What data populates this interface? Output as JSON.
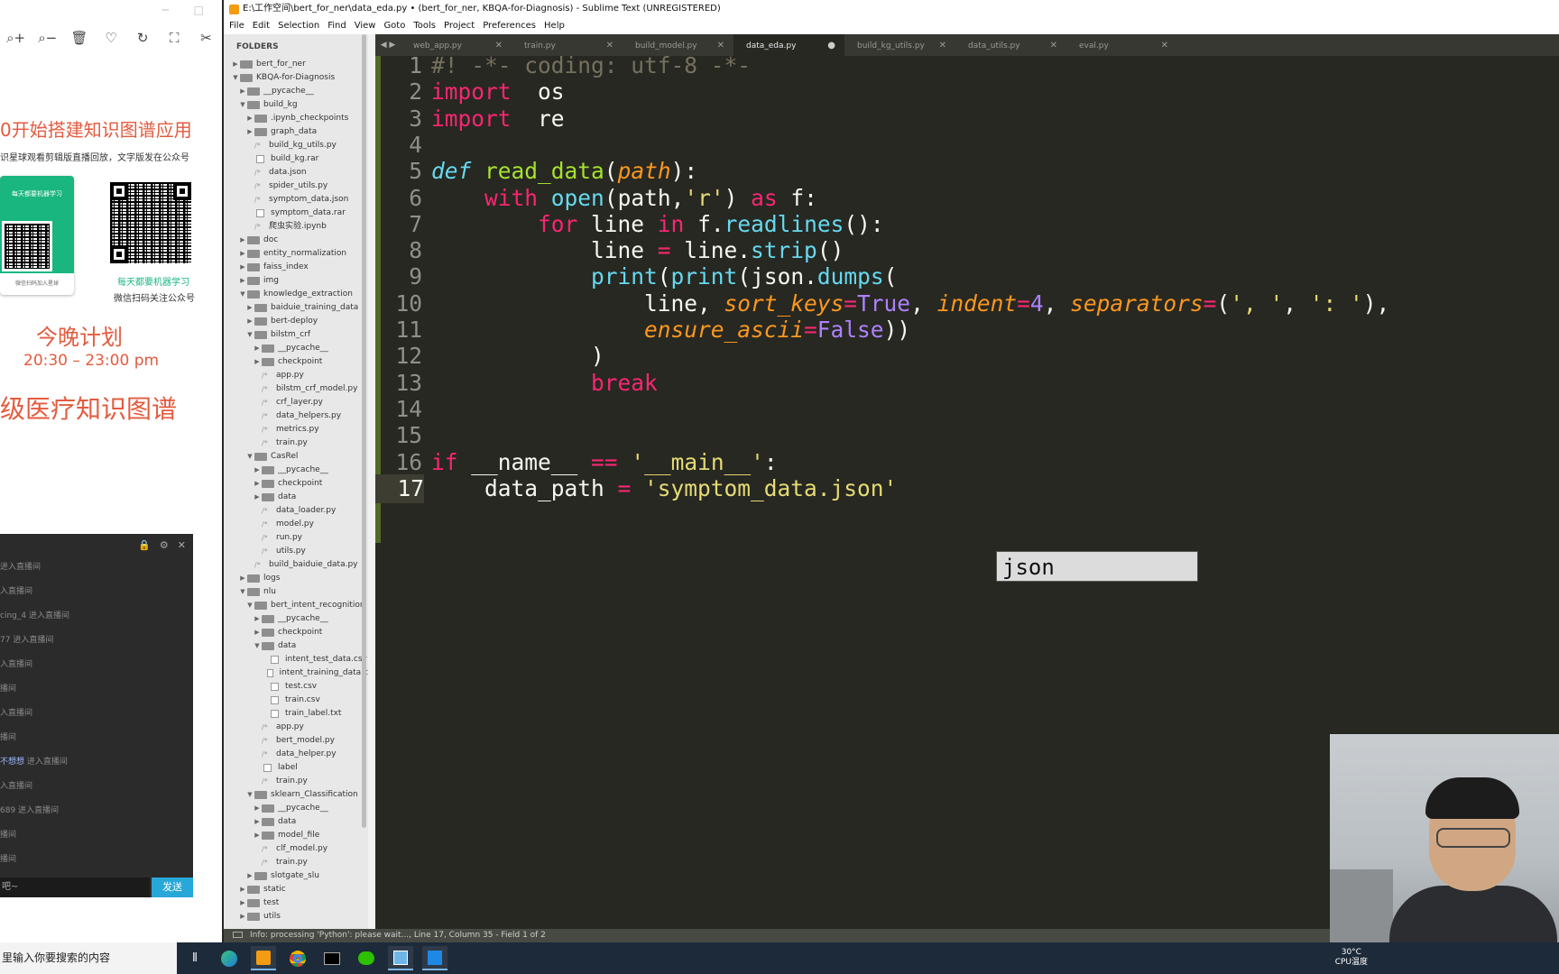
{
  "viewer": {
    "toolbar": [
      "⌕+",
      "⌕−",
      "🗑",
      "♡",
      "↻",
      "⛶",
      "✂"
    ],
    "poster": {
      "title": "0开始搭建知识图谱应用",
      "subtitle": "识星球观看剪辑版直播回放，文字版发在公众号",
      "card_text": "每天都要机器学习",
      "card_foot": "微信扫码加入星球",
      "qr_caption1": "每天都要机器学习",
      "qr_caption2": "微信扫码关注公众号",
      "plan_title": "今晚计划",
      "plan_time": "20:30 – 23:00 pm",
      "plan_topic": "级医疗知识图谱"
    },
    "chat": {
      "lines": [
        {
          "nick": "",
          "text": "进入直播间",
          "highlight": false
        },
        {
          "nick": "",
          "text": "入直播间",
          "highlight": false
        },
        {
          "nick": "cing_4",
          "text": " 进入直播间",
          "highlight": false
        },
        {
          "nick": "77",
          "text": " 进入直播间",
          "highlight": false
        },
        {
          "nick": "",
          "text": "入直播间",
          "highlight": false
        },
        {
          "nick": "",
          "text": "播间",
          "highlight": false
        },
        {
          "nick": "",
          "text": "入直播间",
          "highlight": false
        },
        {
          "nick": "",
          "text": "播间",
          "highlight": false
        },
        {
          "nick": "不想想",
          "text": " 进入直播间",
          "highlight": true
        },
        {
          "nick": "",
          "text": "入直播间",
          "highlight": false
        },
        {
          "nick": "689",
          "text": " 进入直播间",
          "highlight": false
        },
        {
          "nick": "",
          "text": "播间",
          "highlight": false
        },
        {
          "nick": "",
          "text": "播间",
          "highlight": false
        }
      ],
      "input_value": "吧~",
      "send_label": "发送"
    }
  },
  "sublime": {
    "title": "E:\\工作空间\\bert_for_ner\\data_eda.py • (bert_for_ner, KBQA-for-Diagnosis) - Sublime Text (UNREGISTERED)",
    "menu": [
      "File",
      "Edit",
      "Selection",
      "Find",
      "View",
      "Goto",
      "Tools",
      "Project",
      "Preferences",
      "Help"
    ],
    "sidebar_header": "FOLDERS",
    "tree": [
      {
        "d": 0,
        "t": "folder",
        "o": false,
        "n": "bert_for_ner"
      },
      {
        "d": 0,
        "t": "folder",
        "o": true,
        "n": "KBQA-for-Diagnosis"
      },
      {
        "d": 1,
        "t": "folder",
        "o": false,
        "n": "__pycache__"
      },
      {
        "d": 1,
        "t": "folder",
        "o": true,
        "n": "build_kg"
      },
      {
        "d": 2,
        "t": "folder",
        "o": false,
        "n": ".ipynb_checkpoints"
      },
      {
        "d": 2,
        "t": "folder",
        "o": false,
        "n": "graph_data"
      },
      {
        "d": 2,
        "t": "py",
        "n": "build_kg_utils.py"
      },
      {
        "d": 2,
        "t": "file",
        "n": "build_kg.rar"
      },
      {
        "d": 2,
        "t": "py",
        "n": "data.json"
      },
      {
        "d": 2,
        "t": "py",
        "n": "spider_utils.py"
      },
      {
        "d": 2,
        "t": "py",
        "n": "symptom_data.json"
      },
      {
        "d": 2,
        "t": "file",
        "n": "symptom_data.rar"
      },
      {
        "d": 2,
        "t": "py",
        "n": "爬虫实验.ipynb"
      },
      {
        "d": 1,
        "t": "folder",
        "o": false,
        "n": "doc"
      },
      {
        "d": 1,
        "t": "folder",
        "o": false,
        "n": "entity_normalization"
      },
      {
        "d": 1,
        "t": "folder",
        "o": false,
        "n": "faiss_index"
      },
      {
        "d": 1,
        "t": "folder",
        "o": false,
        "n": "img"
      },
      {
        "d": 1,
        "t": "folder",
        "o": true,
        "n": "knowledge_extraction"
      },
      {
        "d": 2,
        "t": "folder",
        "o": false,
        "n": "baiduie_training_data"
      },
      {
        "d": 2,
        "t": "folder",
        "o": false,
        "n": "bert-deploy"
      },
      {
        "d": 2,
        "t": "folder",
        "o": true,
        "n": "bilstm_crf"
      },
      {
        "d": 3,
        "t": "folder",
        "o": false,
        "n": "__pycache__"
      },
      {
        "d": 3,
        "t": "folder",
        "o": false,
        "n": "checkpoint"
      },
      {
        "d": 3,
        "t": "py",
        "n": "app.py"
      },
      {
        "d": 3,
        "t": "py",
        "n": "bilstm_crf_model.py"
      },
      {
        "d": 3,
        "t": "py",
        "n": "crf_layer.py"
      },
      {
        "d": 3,
        "t": "py",
        "n": "data_helpers.py"
      },
      {
        "d": 3,
        "t": "py",
        "n": "metrics.py"
      },
      {
        "d": 3,
        "t": "py",
        "n": "train.py"
      },
      {
        "d": 2,
        "t": "folder",
        "o": true,
        "n": "CasRel"
      },
      {
        "d": 3,
        "t": "folder",
        "o": false,
        "n": "__pycache__"
      },
      {
        "d": 3,
        "t": "folder",
        "o": false,
        "n": "checkpoint"
      },
      {
        "d": 3,
        "t": "folder",
        "o": false,
        "n": "data"
      },
      {
        "d": 3,
        "t": "py",
        "n": "data_loader.py"
      },
      {
        "d": 3,
        "t": "py",
        "n": "model.py"
      },
      {
        "d": 3,
        "t": "py",
        "n": "run.py"
      },
      {
        "d": 3,
        "t": "py",
        "n": "utils.py"
      },
      {
        "d": 2,
        "t": "py",
        "n": "build_baiduie_data.py"
      },
      {
        "d": 1,
        "t": "folder",
        "o": false,
        "n": "logs"
      },
      {
        "d": 1,
        "t": "folder",
        "o": true,
        "n": "nlu"
      },
      {
        "d": 2,
        "t": "folder",
        "o": true,
        "n": "bert_intent_recognition"
      },
      {
        "d": 3,
        "t": "folder",
        "o": false,
        "n": "__pycache__"
      },
      {
        "d": 3,
        "t": "folder",
        "o": false,
        "n": "checkpoint"
      },
      {
        "d": 3,
        "t": "folder",
        "o": true,
        "n": "data"
      },
      {
        "d": 4,
        "t": "file",
        "n": "intent_test_data.csv"
      },
      {
        "d": 4,
        "t": "file",
        "n": "intent_training_data.c"
      },
      {
        "d": 4,
        "t": "file",
        "n": "test.csv"
      },
      {
        "d": 4,
        "t": "file",
        "n": "train.csv"
      },
      {
        "d": 4,
        "t": "file",
        "n": "train_label.txt"
      },
      {
        "d": 3,
        "t": "py",
        "n": "app.py"
      },
      {
        "d": 3,
        "t": "py",
        "n": "bert_model.py"
      },
      {
        "d": 3,
        "t": "py",
        "n": "data_helper.py"
      },
      {
        "d": 3,
        "t": "file",
        "n": "label"
      },
      {
        "d": 3,
        "t": "py",
        "n": "train.py"
      },
      {
        "d": 2,
        "t": "folder",
        "o": true,
        "n": "sklearn_Classification"
      },
      {
        "d": 3,
        "t": "folder",
        "o": false,
        "n": "__pycache__"
      },
      {
        "d": 3,
        "t": "folder",
        "o": false,
        "n": "data"
      },
      {
        "d": 3,
        "t": "folder",
        "o": false,
        "n": "model_file"
      },
      {
        "d": 3,
        "t": "py",
        "n": "clf_model.py"
      },
      {
        "d": 3,
        "t": "py",
        "n": "train.py"
      },
      {
        "d": 2,
        "t": "folder",
        "o": false,
        "n": "slotgate_slu"
      },
      {
        "d": 1,
        "t": "folder",
        "o": false,
        "n": "static"
      },
      {
        "d": 1,
        "t": "folder",
        "o": false,
        "n": "test"
      },
      {
        "d": 1,
        "t": "folder",
        "o": false,
        "n": "utils"
      }
    ],
    "tabs": [
      {
        "label": "web_app.py",
        "active": false,
        "dirty": false
      },
      {
        "label": "train.py",
        "active": false,
        "dirty": false
      },
      {
        "label": "build_model.py",
        "active": false,
        "dirty": false
      },
      {
        "label": "data_eda.py",
        "active": true,
        "dirty": true
      },
      {
        "label": "build_kg_utils.py",
        "active": false,
        "dirty": false
      },
      {
        "label": "data_utils.py",
        "active": false,
        "dirty": false
      },
      {
        "label": "eval.py",
        "active": false,
        "dirty": false
      }
    ],
    "code_lines": [
      [
        [
          "c",
          "#! -*- coding: utf-8 -*-"
        ]
      ],
      [
        [
          "k",
          "import"
        ],
        [
          "",
          "  os"
        ]
      ],
      [
        [
          "k",
          "import"
        ],
        [
          "",
          "  re"
        ]
      ],
      [],
      [
        [
          "d",
          "def"
        ],
        [
          "",
          " "
        ],
        [
          "f",
          "read_data"
        ],
        [
          "",
          "("
        ],
        [
          "p",
          "path"
        ],
        [
          "",
          "):"
        ]
      ],
      [
        [
          "",
          "    "
        ],
        [
          "k",
          "with"
        ],
        [
          "",
          " "
        ],
        [
          "b",
          "open"
        ],
        [
          "",
          "(path,"
        ],
        [
          "s",
          "'r'"
        ],
        [
          ") ",
          ""
        ],
        [
          "k",
          "as"
        ],
        [
          "",
          " f:"
        ]
      ],
      [
        [
          "",
          "        "
        ],
        [
          "k",
          "for"
        ],
        [
          "",
          " line "
        ],
        [
          "k",
          "in"
        ],
        [
          "",
          " f."
        ],
        [
          "b",
          "readlines"
        ],
        [
          "",
          "():"
        ]
      ],
      [
        [
          "",
          "            line "
        ],
        [
          "k",
          "="
        ],
        [
          "",
          " line."
        ],
        [
          "b",
          "strip"
        ],
        [
          "",
          "()"
        ]
      ],
      [
        [
          "",
          "            "
        ],
        [
          "b",
          "print"
        ],
        [
          "",
          "("
        ],
        [
          "b",
          "print"
        ],
        [
          "",
          "(json."
        ],
        [
          "b",
          "dumps"
        ],
        [
          "",
          "("
        ]
      ],
      [
        [
          "",
          "                line, "
        ],
        [
          "p",
          "sort_keys"
        ],
        [
          "k",
          "="
        ],
        [
          "n",
          "True"
        ],
        [
          "",
          ", "
        ],
        [
          "p",
          "indent"
        ],
        [
          "k",
          "="
        ],
        [
          "n",
          "4"
        ],
        [
          "",
          ", "
        ],
        [
          "p",
          "separators"
        ],
        [
          "k",
          "="
        ],
        [
          "",
          "("
        ],
        [
          "s",
          "', '"
        ],
        [
          "",
          ", "
        ],
        [
          "s",
          "': '"
        ],
        [
          "",
          "),"
        ]
      ],
      [
        [
          "",
          "                "
        ],
        [
          "p",
          "ensure_ascii"
        ],
        [
          "k",
          "="
        ],
        [
          "n",
          "False"
        ],
        [
          "",
          "))"
        ]
      ],
      [
        [
          "",
          "            )"
        ]
      ],
      [
        [
          "",
          "            "
        ],
        [
          "k",
          "break"
        ]
      ],
      [],
      [],
      [
        [
          "k",
          "if"
        ],
        [
          "",
          " __name__ "
        ],
        [
          "k",
          "=="
        ],
        [
          "",
          " "
        ],
        [
          "s",
          "'__main__'"
        ],
        [
          "",
          ":"
        ]
      ],
      [
        [
          "",
          "    data_path "
        ],
        [
          "k",
          "="
        ],
        [
          "",
          " "
        ],
        [
          "s",
          "'symptom_data.json'"
        ]
      ]
    ],
    "current_line": 17,
    "autocomplete": "json",
    "status": "Info: processing 'Python': please wait..., Line 17, Column 35 - Field 1 of 2"
  },
  "taskbar": {
    "search_placeholder": "在这里输入你要搜索的内容",
    "search_value": "里输入你要搜索的内容",
    "temp": "30°C",
    "temp_label": "CPU温度"
  },
  "colors": {
    "editor_bg": "#272822",
    "keyword": "#f92672",
    "function": "#a6e22e",
    "string": "#e6db74",
    "constant": "#ae81ff",
    "param": "#fd971f",
    "builtin": "#66d9ef",
    "comment": "#75715e"
  }
}
